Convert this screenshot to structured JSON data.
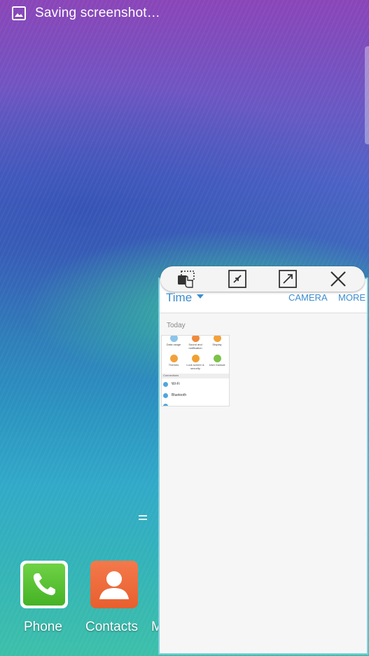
{
  "status_bar": {
    "icon": "image-icon",
    "notification_text": "Saving screenshot…"
  },
  "popup_toolbar": {
    "buttons": [
      {
        "icon": "screen-capture-icon"
      },
      {
        "icon": "minimize-icon"
      },
      {
        "icon": "maximize-icon"
      },
      {
        "icon": "close-icon"
      }
    ]
  },
  "popup_window": {
    "title": "Time",
    "actions": [
      "CAMERA",
      "MORE"
    ],
    "section": "Today",
    "thumbnail": {
      "tiles": [
        "Data usage",
        "Sound and notification",
        "Display",
        "Themes",
        "Lock screen & security",
        "User manual"
      ],
      "section_header": "Connections",
      "rows": [
        "Wi-Fi",
        "Bluetooth"
      ]
    }
  },
  "dock": {
    "apps": [
      {
        "label": "Phone",
        "icon": "phone-icon",
        "color": "#4fbd2c"
      },
      {
        "label": "Contacts",
        "icon": "contacts-icon",
        "color": "#ee6a37"
      },
      {
        "label": "M"
      }
    ]
  }
}
